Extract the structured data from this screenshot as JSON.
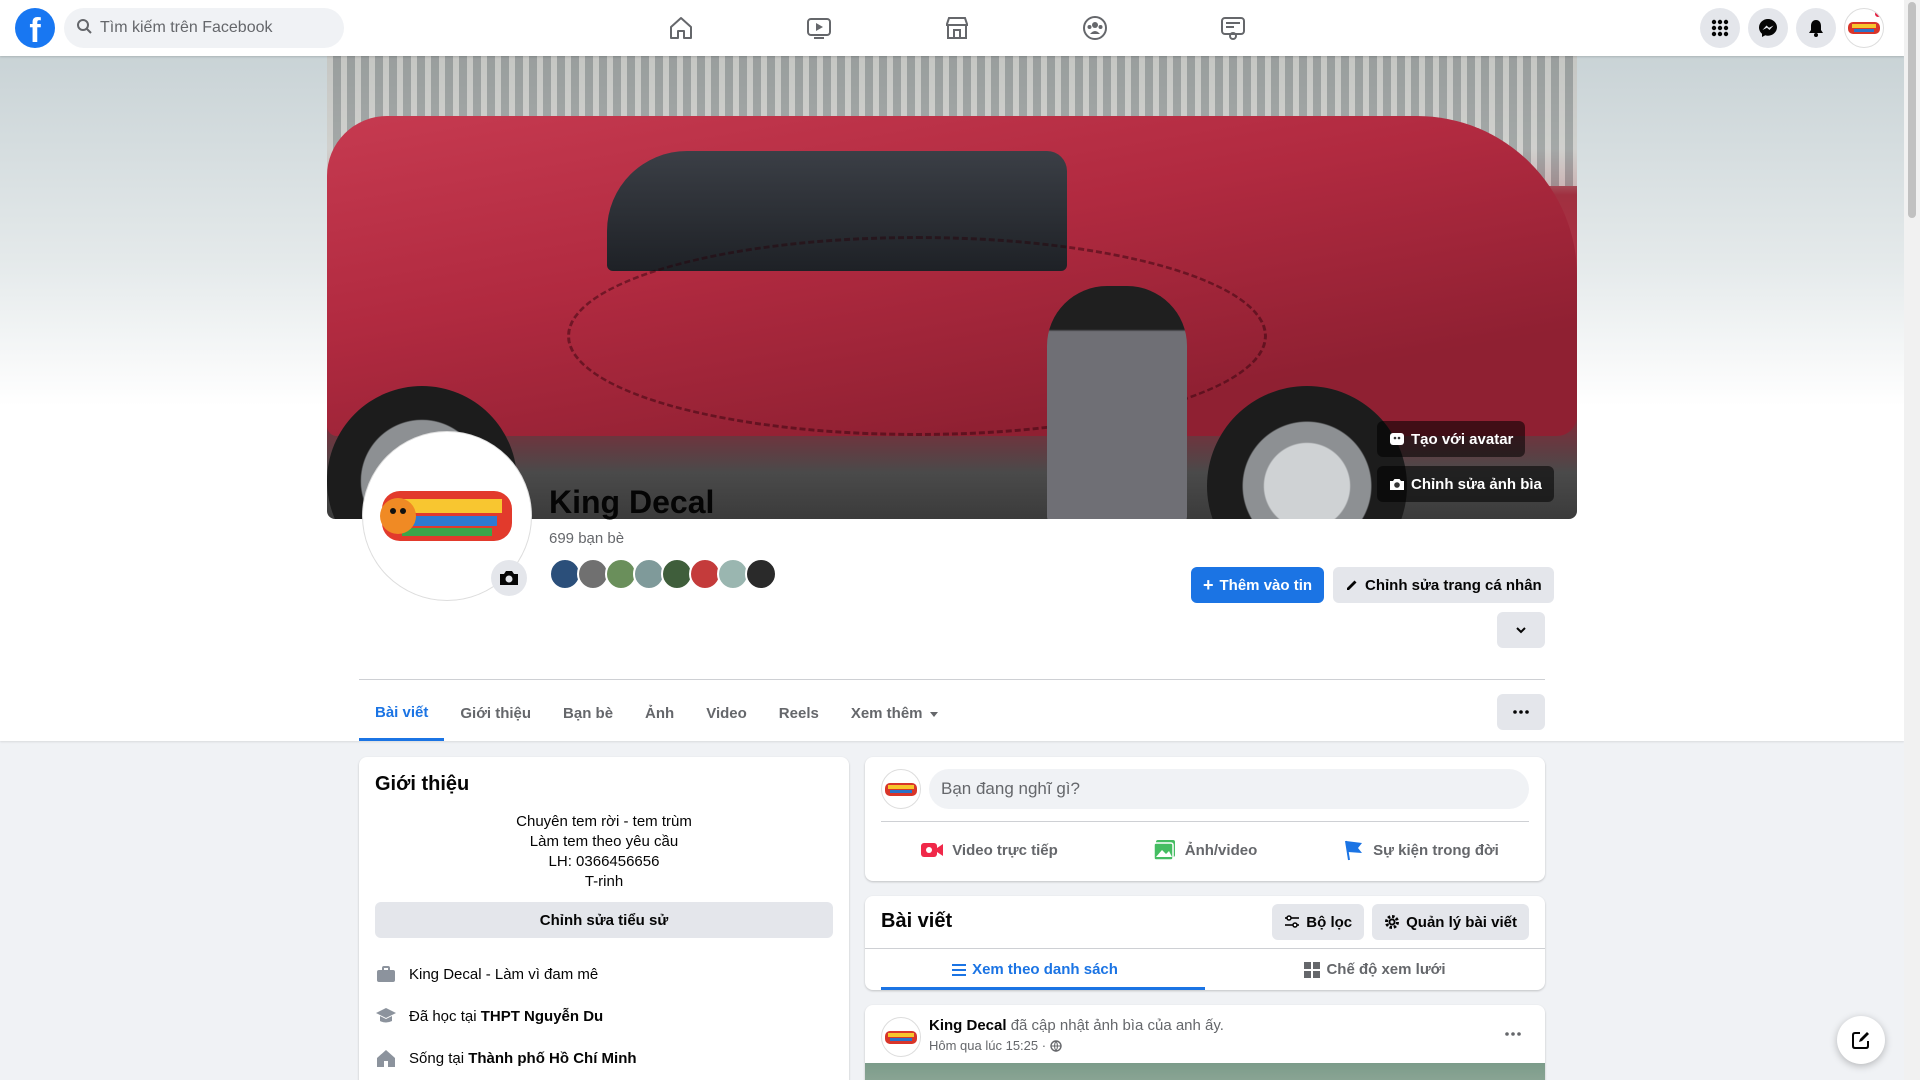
{
  "search": {
    "placeholder": "Tìm kiếm trên Facebook"
  },
  "nav": {
    "icons": [
      "home-icon",
      "video-icon",
      "marketplace-icon",
      "groups-icon",
      "gaming-icon"
    ]
  },
  "cover": {
    "create_avatar_label": "Tạo với avatar",
    "edit_cover_label": "Chỉnh sửa ảnh bìa"
  },
  "profile": {
    "name": "King Decal",
    "friends_count": "699 bạn bè",
    "add_story_label": "Thêm vào tin",
    "edit_profile_label": "Chỉnh sửa trang cá nhân"
  },
  "tabs": [
    {
      "label": "Bài viết",
      "active": true
    },
    {
      "label": "Giới thiệu"
    },
    {
      "label": "Bạn bè"
    },
    {
      "label": "Ảnh"
    },
    {
      "label": "Video"
    },
    {
      "label": "Reels"
    },
    {
      "label": "Xem thêm"
    }
  ],
  "intro": {
    "title": "Giới thiệu",
    "bio_lines": [
      "Chuyên tem rời - tem trùm",
      "Làm tem theo yêu cầu",
      "LH: 0366456656",
      "T-rinh"
    ],
    "edit_bio_label": "Chỉnh sửa tiểu sử",
    "work_text": "King Decal - Làm vì đam mê",
    "education_prefix": "Đã học tại",
    "education_place": "THPT Nguyễn Du",
    "lives_prefix": "Sống tại",
    "lives_place": "Thành phố Hồ Chí Minh"
  },
  "composer": {
    "placeholder": "Bạn đang nghĩ gì?",
    "live_label": "Video trực tiếp",
    "photo_label": "Ảnh/video",
    "event_label": "Sự kiện trong đời"
  },
  "posts": {
    "title": "Bài viết",
    "filter_label": "Bộ lọc",
    "manage_label": "Quản lý bài viết",
    "list_view_label": "Xem theo danh sách",
    "grid_view_label": "Chế độ xem lưới"
  },
  "post": {
    "author": "King Decal",
    "action": " đã cập nhật ảnh bìa của anh ấy.",
    "time": "Hôm qua lúc 15:25 ·"
  },
  "colors": {
    "accent": "#1b74e4",
    "fb_blue": "#1877f2",
    "notification": "#e41e3f"
  }
}
